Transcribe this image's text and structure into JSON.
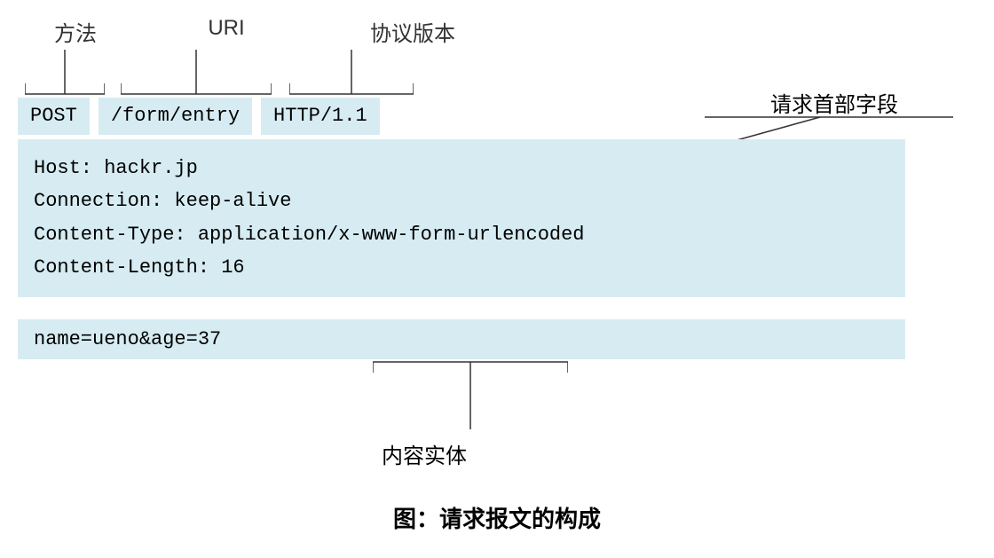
{
  "labels": {
    "method": "方法",
    "uri": "URI",
    "version": "协议版本",
    "header_field": "请求首部字段",
    "body": "内容实体"
  },
  "request_line": {
    "method": "POST",
    "uri": "/form/entry",
    "version": "HTTP/1.1"
  },
  "headers": {
    "line1": "Host: hackr.jp",
    "line2": "Connection: keep-alive",
    "line3": "Content-Type: application/x-www-form-urlencoded",
    "line4": "Content-Length: 16"
  },
  "body": "name=ueno&age=37",
  "caption_prefix": "图：",
  "caption_text": "请求报文的构成"
}
